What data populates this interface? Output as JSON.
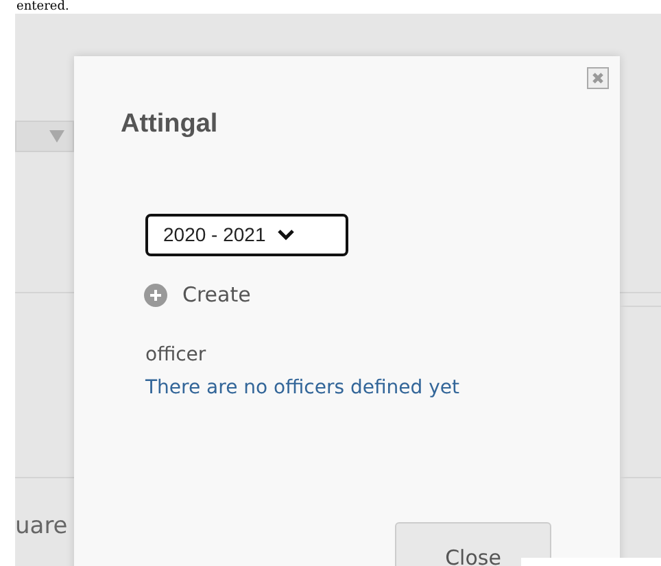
{
  "document_text": "entered.",
  "background": {
    "cell_text": "uare"
  },
  "dialog": {
    "title": "Attingal",
    "year_select": {
      "value": "2020 - 2021"
    },
    "create_button": {
      "label": "Create"
    },
    "field_label": "officer",
    "empty_message": "There are no officers defined yet",
    "close_button": {
      "label": "Close"
    }
  }
}
